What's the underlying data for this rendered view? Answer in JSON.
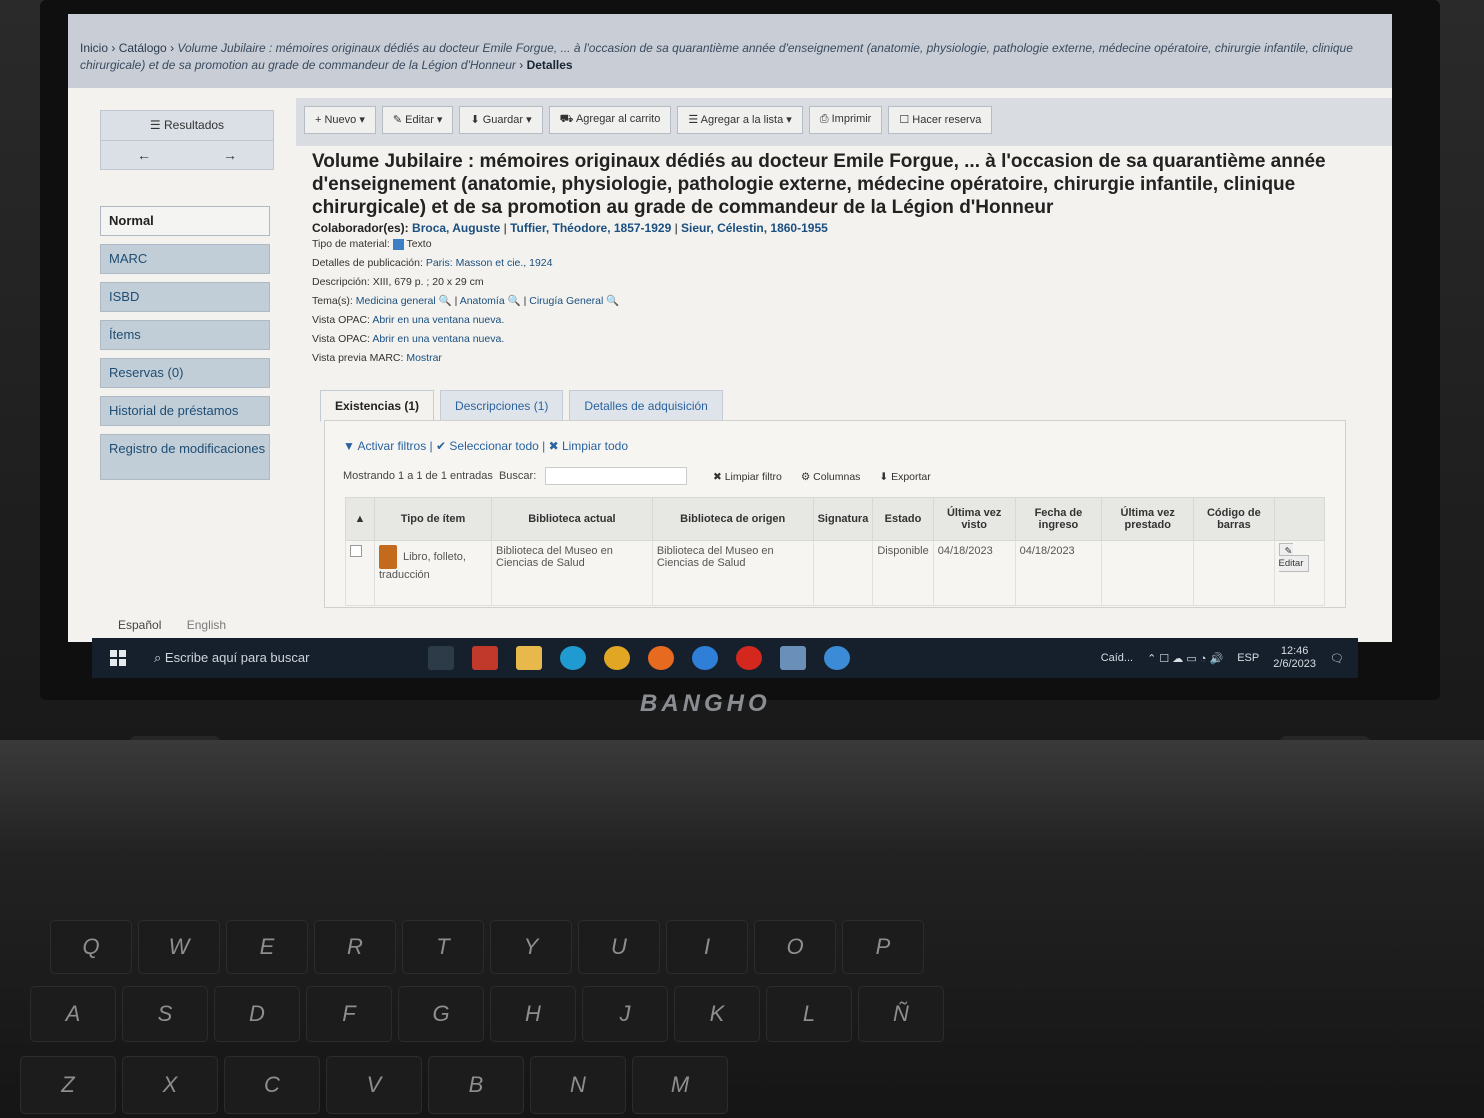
{
  "breadcrumb": {
    "inicio": "Inicio",
    "catalogo": "Catálogo",
    "record": "Volume Jubilaire : mémoires originaux dédiés au docteur Emile Forgue, ... à l'occasion de sa quarantième année d'enseignement (anatomie, physiologie, pathologie externe, médecine opératoire, chirurgie infantile, clinique chirurgicale) et de sa promotion au grade de commandeur de la Légion d'Honneur",
    "current": "Detalles"
  },
  "sidebar": {
    "resultados": "Resultados",
    "prev": "←",
    "next": "→",
    "views": [
      "Normal",
      "MARC",
      "ISBD",
      "Ítems",
      "Reservas (0)",
      "Historial de préstamos",
      "Registro de modificaciones"
    ]
  },
  "toolbar": {
    "nuevo": "+ Nuevo ▾",
    "editar": "✎ Editar ▾",
    "guardar": "⬇ Guardar ▾",
    "carrito": "⛟ Agregar al carrito",
    "lista": "☰ Agregar a la lista ▾",
    "imprimir": "⎙ Imprimir",
    "reserva": "☐ Hacer reserva"
  },
  "record": {
    "title": "Volume Jubilaire : mémoires originaux dédiés au docteur Emile Forgue, ... à l'occasion de sa quarantième année d'enseignement (anatomie, physiologie, pathologie externe, médecine opératoire, chirurgie infantile, clinique chirurgicale) et de sa promotion au grade de commandeur de la Légion d'Honneur",
    "colab_label": "Colaborador(es):",
    "colab1": "Broca, Auguste",
    "colab2": "Tuffier, Théodore, 1857-1929",
    "colab3": "Sieur, Célestin, 1860-1955",
    "material_label": "Tipo de material:",
    "material": "Texto",
    "pub_label": "Detalles de publicación:",
    "pub": "Paris: Masson et cie., 1924",
    "desc_label": "Descripción:",
    "desc": "XIII, 679 p. ; 20 x 29 cm",
    "tema_label": "Tema(s):",
    "tema1": "Medicina general",
    "tema2": "Anatomía",
    "tema3": "Cirugía General",
    "opac_label": "Vista OPAC:",
    "opac": "Abrir en una ventana nueva.",
    "marc_label": "Vista previa MARC:",
    "marc": "Mostrar"
  },
  "tabs": [
    "Existencias (1)",
    "Descripciones (1)",
    "Detalles de adquisición"
  ],
  "holdings": {
    "filters": "▼ Activar filtros | ✔ Seleccionar todo | ✖ Limpiar todo",
    "showing": "Mostrando 1 a 1 de 1 entradas",
    "buscar": "Buscar:",
    "limpiar": "✖ Limpiar filtro",
    "columnas": "⚙ Columnas",
    "exportar": "⬇ Exportar",
    "headers": [
      "Tipo de ítem",
      "Biblioteca actual",
      "Biblioteca de origen",
      "Signatura",
      "Estado",
      "Última vez visto",
      "Fecha de ingreso",
      "Última vez prestado",
      "Código de barras"
    ],
    "row": {
      "tipo": "Libro, folleto, traducción",
      "actual": "Biblioteca del Museo en Ciencias de Salud",
      "origen": "Biblioteca del Museo en Ciencias de Salud",
      "signatura": "",
      "estado": "Disponible",
      "visto": "04/18/2023",
      "ingreso": "04/18/2023",
      "prestado": "",
      "barras": "",
      "editar": "✎ Editar"
    }
  },
  "languages": {
    "es": "Español",
    "en": "English"
  },
  "taskbar": {
    "search": "Escribe aquí para buscar",
    "weather": "Caíd...",
    "lang": "ESP",
    "time": "12:46",
    "date": "2/6/2023"
  },
  "laptop": {
    "brand": "BANGHO"
  },
  "keys": {
    "row1": [
      "Q",
      "W",
      "E",
      "R",
      "T",
      "Y",
      "U",
      "I",
      "O",
      "P"
    ],
    "row2": [
      "A",
      "S",
      "D",
      "F",
      "G",
      "H",
      "J",
      "K",
      "L",
      "Ñ"
    ],
    "row3": [
      "Z",
      "X",
      "C",
      "V",
      "B",
      "N",
      "M"
    ]
  }
}
